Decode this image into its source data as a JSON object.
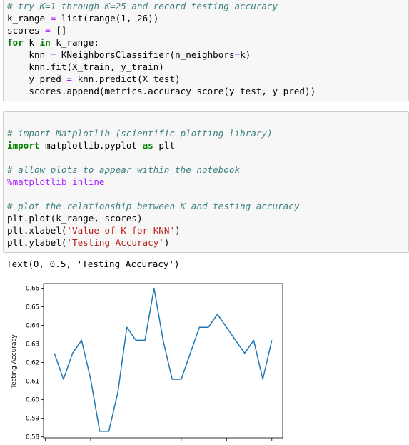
{
  "cell1": {
    "comment": "# try K=1 through K=25 and record testing accuracy",
    "line2_a": "k_range ",
    "line2_op": "=",
    "line2_b": " list(range(",
    "line2_n1": "1",
    "line2_c": ", ",
    "line2_n2": "26",
    "line2_d": "))",
    "line3_a": "scores ",
    "line3_op": "=",
    "line3_b": " []",
    "line4_for": "for",
    "line4_a": " k ",
    "line4_in": "in",
    "line4_b": " k_range:",
    "line5_a": "    knn ",
    "line5_op": "=",
    "line5_b": " KNeighborsClassifier(n_neighbors",
    "line5_op2": "=",
    "line5_c": "k)",
    "line6": "    knn.fit(X_train, y_train)",
    "line7_a": "    y_pred ",
    "line7_op": "=",
    "line7_b": " knn.predict(X_test)",
    "line8": "    scores.append(metrics.accuracy_score(y_test, y_pred))"
  },
  "cell2": {
    "comment1": "# import Matplotlib (scientific plotting library)",
    "import_kw": "import",
    "import_mod": " matplotlib.pyplot ",
    "as_kw": "as",
    "import_alias": " plt",
    "comment2": "# allow plots to appear within the notebook",
    "magic": "%matplotlib inline",
    "comment3": "# plot the relationship between K and testing accuracy",
    "plot_line": "plt.plot(k_range, scores)",
    "xlabel_a": "plt.xlabel(",
    "xlabel_str": "'Value of K for KNN'",
    "xlabel_b": ")",
    "ylabel_a": "plt.ylabel(",
    "ylabel_str": "'Testing Accuracy'",
    "ylabel_b": ")"
  },
  "output": {
    "text": "Text(0, 0.5, 'Testing Accuracy')"
  },
  "chart_data": {
    "type": "line",
    "ylabel": "Testing Accuracy",
    "ylim": [
      0.5795,
      0.6625
    ],
    "xlim": [
      -0.2,
      26.2
    ],
    "yticks": [
      "0.66",
      "0.65",
      "0.64",
      "0.63",
      "0.62",
      "0.61",
      "0.60",
      "0.59",
      "0.58"
    ],
    "color": "#1f77b4",
    "series": [
      {
        "x": [
          1,
          2,
          3,
          4,
          5,
          6,
          7,
          8,
          9,
          10,
          11,
          12,
          13,
          14,
          15,
          16,
          17,
          18,
          19,
          20,
          21,
          22,
          23,
          24,
          25
        ],
        "values": [
          0.625,
          0.611,
          0.625,
          0.632,
          0.611,
          0.583,
          0.583,
          0.604,
          0.639,
          0.632,
          0.632,
          0.66,
          0.632,
          0.611,
          0.611,
          0.625,
          0.639,
          0.639,
          0.646,
          0.639,
          0.632,
          0.625,
          0.632,
          0.611,
          0.632
        ]
      }
    ]
  }
}
